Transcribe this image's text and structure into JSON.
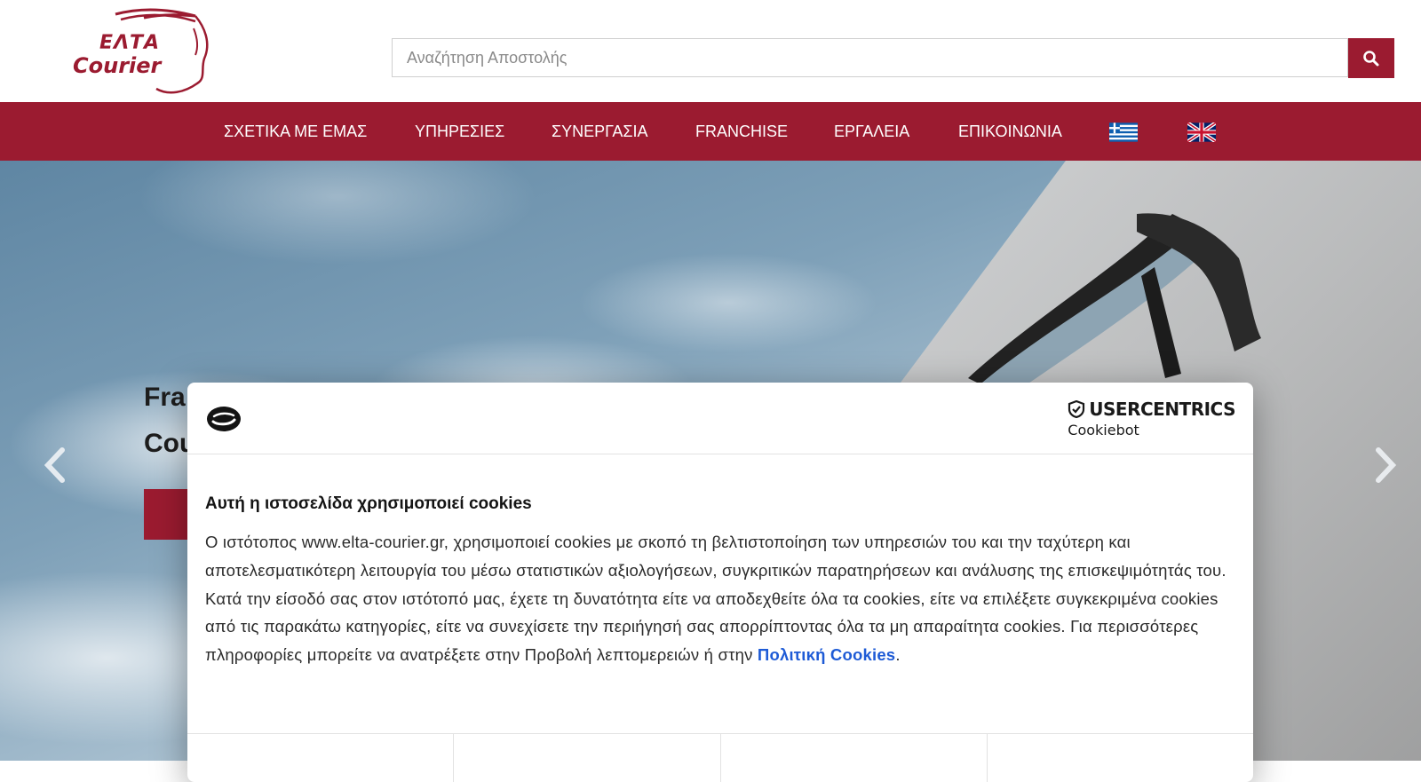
{
  "header": {
    "logo": {
      "line1": "ΕΛΤΑ",
      "line2": "Courier"
    },
    "search": {
      "placeholder": "Αναζήτηση Αποστολής",
      "button_icon": "search-icon"
    }
  },
  "nav": {
    "items": [
      {
        "label": "ΣΧΕΤΙΚΑ ΜΕ ΕΜΑΣ"
      },
      {
        "label": "ΥΠΗΡΕΣΙΕΣ"
      },
      {
        "label": "ΣΥΝΕΡΓΑΣΙΑ"
      },
      {
        "label": "FRANCHISE"
      },
      {
        "label": "ΕΡΓΑΛΕΙΑ"
      },
      {
        "label": "ΕΠΙΚΟΙΝΩΝΙΑ"
      }
    ],
    "languages": [
      {
        "icon": "greek-flag-icon"
      },
      {
        "icon": "uk-flag-icon"
      }
    ]
  },
  "hero": {
    "title_line1": "Fra",
    "title_line2": "Cou",
    "prev_icon": "chevron-left-icon",
    "next_icon": "chevron-right-icon"
  },
  "cookie_dialog": {
    "brand": {
      "name": "USERCENTRICS",
      "sub": "Cookiebot"
    },
    "title": "Αυτή η ιστοσελίδα χρησιμοποιεί cookies",
    "body": "Ο ιστότοπος www.elta-courier.gr, χρησιμοποιεί cookies με σκοπό τη βελτιστοποίηση των υπηρεσιών του και την ταχύτερη και αποτελεσματικότερη λειτουργία του μέσω στατιστικών αξιολογήσεων, συγκριτικών παρατηρήσεων και ανάλυσης της επισκεψιμότητάς του. Κατά την είσοδό σας στον  ιστότοπό μας, έχετε  τη δυνατότητα είτε να αποδεχθείτε όλα τα cookies, είτε να επιλέξετε συγκεκριμένα cookies από τις παρακάτω κατηγορίες, είτε να συνεχίσετε την περιήγησή σας απορρίπτοντας όλα τα μη απαραίτητα cookies. Για περισσότερες πληροφορίες μπορείτε να ανατρέξετε στην Προβολή λεπτομερειών ή στην ",
    "link_label": "Πολιτική Cookies",
    "body_end": ".",
    "accent_color": "#1e5bd6"
  },
  "colors": {
    "brand": "#9b1b30"
  }
}
